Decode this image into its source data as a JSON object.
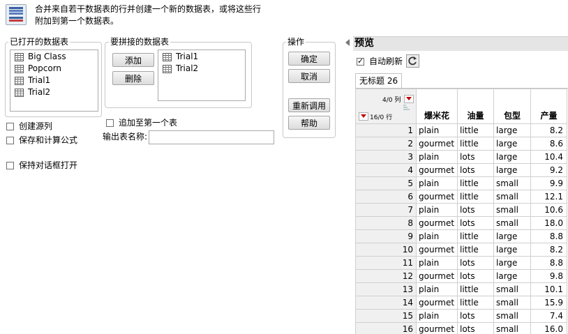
{
  "header": {
    "description": "合并来自若干数据表的行并创建一个新的数据表，或将这些行附加到第一个数据表。"
  },
  "open_tables": {
    "title": "已打开的数据表",
    "items": [
      "Big Class",
      "Popcorn",
      "Trial1",
      "Trial2"
    ]
  },
  "concat_tables": {
    "title": "要拼接的数据表",
    "add_label": "添加",
    "remove_label": "删除",
    "items": [
      "Trial1",
      "Trial2"
    ]
  },
  "actions": {
    "title": "操作",
    "ok_label": "确定",
    "cancel_label": "取消",
    "recall_label": "重新调用",
    "help_label": "帮助"
  },
  "options": {
    "create_source_column": "创建源列",
    "save_formula": "保存和计算公式",
    "keep_dialog_open": "保持对话框打开",
    "append_to_first": "追加至第一个表",
    "output_name_label": "输出表名称:",
    "output_name_value": ""
  },
  "preview": {
    "title": "预览",
    "auto_refresh_label": "自动刷新",
    "auto_refresh_checked": true,
    "tab_label": "无标题 26",
    "cols_summary": "4/0 列",
    "rows_summary": "16/0 行",
    "columns": [
      "爆米花",
      "油量",
      "包型",
      "产量"
    ],
    "rows": [
      [
        "1",
        "plain",
        "little",
        "large",
        "8.2"
      ],
      [
        "2",
        "gourmet",
        "little",
        "large",
        "8.6"
      ],
      [
        "3",
        "plain",
        "lots",
        "large",
        "10.4"
      ],
      [
        "4",
        "gourmet",
        "lots",
        "large",
        "9.2"
      ],
      [
        "5",
        "plain",
        "little",
        "small",
        "9.9"
      ],
      [
        "6",
        "gourmet",
        "little",
        "small",
        "12.1"
      ],
      [
        "7",
        "plain",
        "lots",
        "small",
        "10.6"
      ],
      [
        "8",
        "gourmet",
        "lots",
        "small",
        "18.0"
      ],
      [
        "9",
        "plain",
        "little",
        "large",
        "8.8"
      ],
      [
        "10",
        "gourmet",
        "little",
        "large",
        "8.2"
      ],
      [
        "11",
        "plain",
        "lots",
        "large",
        "8.8"
      ],
      [
        "12",
        "gourmet",
        "lots",
        "large",
        "9.8"
      ],
      [
        "13",
        "plain",
        "little",
        "small",
        "10.1"
      ],
      [
        "14",
        "gourmet",
        "little",
        "small",
        "15.9"
      ],
      [
        "15",
        "plain",
        "lots",
        "small",
        "7.4"
      ],
      [
        "16",
        "gourmet",
        "lots",
        "small",
        "16.0"
      ]
    ]
  }
}
